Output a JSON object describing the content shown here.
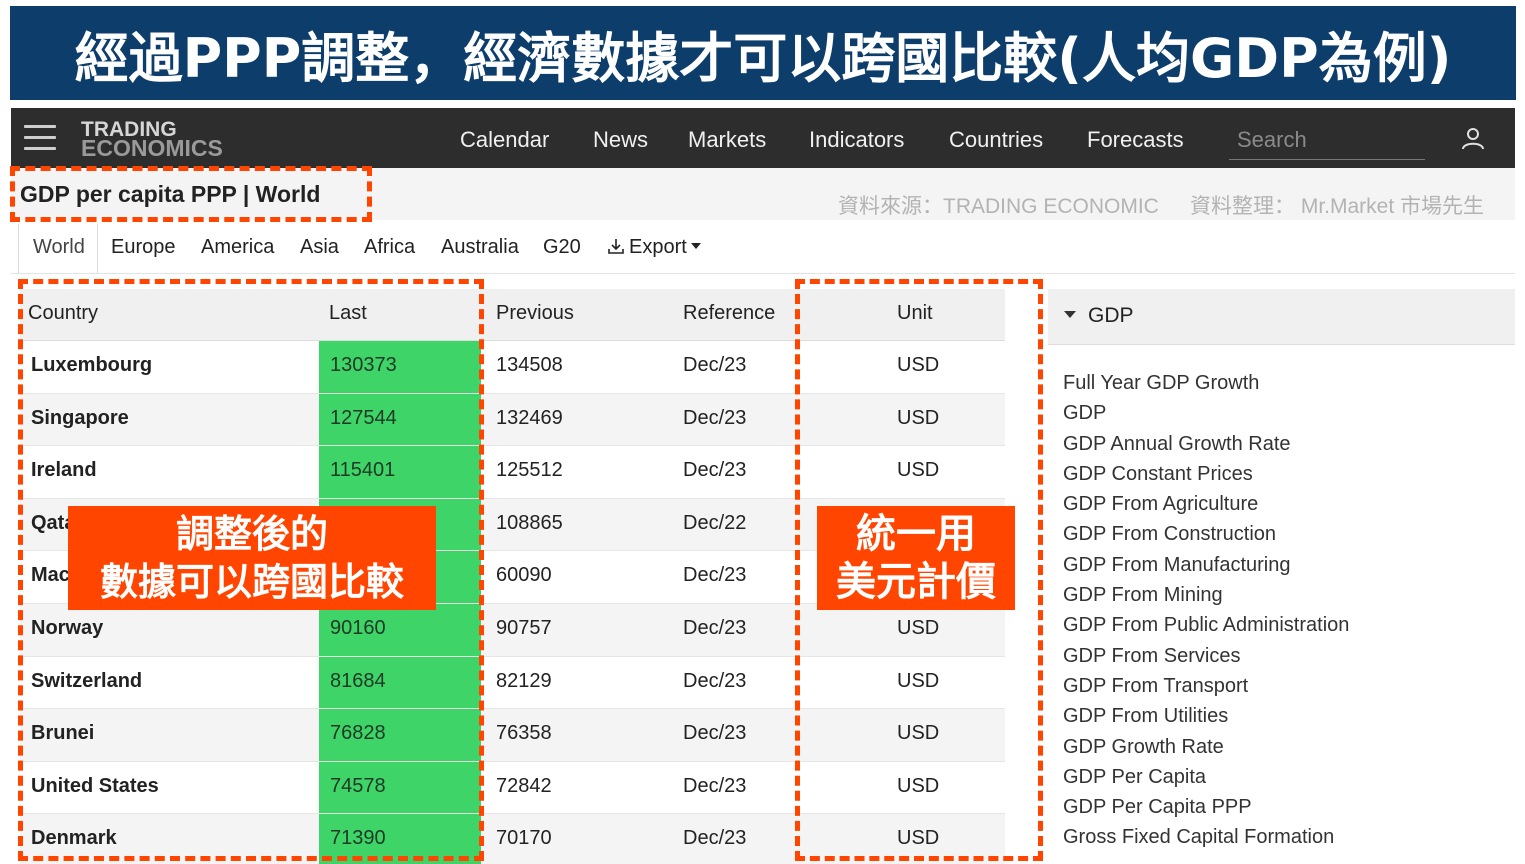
{
  "banner": {
    "text": "經過PPP調整，經濟數據才可以跨國比較(人均GDP為例)"
  },
  "nav": {
    "logo_line1": "TRADING",
    "logo_line2": "ECONOMICS",
    "links": [
      "Calendar",
      "News",
      "Markets",
      "Indicators",
      "Countries",
      "Forecasts"
    ],
    "search_placeholder": "Search",
    "icons": [
      "menu-icon",
      "user-icon"
    ]
  },
  "page": {
    "title": "GDP per capita PPP | World",
    "source": "資料來源：TRADING ECONOMIC",
    "compiled_by": "資料整理： Mr.Market 市場先生"
  },
  "tabs": {
    "items": [
      "World",
      "Europe",
      "America",
      "Asia",
      "Africa",
      "Australia",
      "G20"
    ],
    "active": "World",
    "export_label": "Export"
  },
  "table": {
    "headers": [
      "Country",
      "Last",
      "Previous",
      "Reference",
      "Unit"
    ],
    "rows": [
      {
        "country": "Luxembourg",
        "last": "130373",
        "previous": "134508",
        "reference": "Dec/23",
        "unit": "USD"
      },
      {
        "country": "Singapore",
        "last": "127544",
        "previous": "132469",
        "reference": "Dec/23",
        "unit": "USD"
      },
      {
        "country": "Ireland",
        "last": "115401",
        "previous": "125512",
        "reference": "Dec/23",
        "unit": "USD"
      },
      {
        "country": "Qata",
        "last": "",
        "previous": "108865",
        "reference": "Dec/22",
        "unit": ""
      },
      {
        "country": "Mac",
        "last": "",
        "previous": "60090",
        "reference": "Dec/23",
        "unit": ""
      },
      {
        "country": "Norway",
        "last": "90160",
        "previous": "90757",
        "reference": "Dec/23",
        "unit": "USD"
      },
      {
        "country": "Switzerland",
        "last": "81684",
        "previous": "82129",
        "reference": "Dec/23",
        "unit": "USD"
      },
      {
        "country": "Brunei",
        "last": "76828",
        "previous": "76358",
        "reference": "Dec/23",
        "unit": "USD"
      },
      {
        "country": "United States",
        "last": "74578",
        "previous": "72842",
        "reference": "Dec/23",
        "unit": "USD"
      },
      {
        "country": "Denmark",
        "last": "71390",
        "previous": "70170",
        "reference": "Dec/23",
        "unit": "USD"
      }
    ]
  },
  "annotations": {
    "left": {
      "line1": "調整後的",
      "line2": "數據可以跨國比較"
    },
    "right": {
      "line1": "統一用",
      "line2": "美元計價"
    }
  },
  "sidebar": {
    "header": "GDP",
    "items": [
      "Full Year GDP Growth",
      "GDP",
      "GDP Annual Growth Rate",
      "GDP Constant Prices",
      "GDP From Agriculture",
      "GDP From Construction",
      "GDP From Manufacturing",
      "GDP From Mining",
      "GDP From Public Administration",
      "GDP From Services",
      "GDP From Transport",
      "GDP From Utilities",
      "GDP Growth Rate",
      "GDP Per Capita",
      "GDP Per Capita PPP",
      "Gross Fixed Capital Formation"
    ]
  },
  "colors": {
    "banner_bg": "#0d3d6b",
    "nav_bg": "#2d2d2d",
    "highlight_green": "#3fd467",
    "annotation_orange": "#ff4500"
  }
}
